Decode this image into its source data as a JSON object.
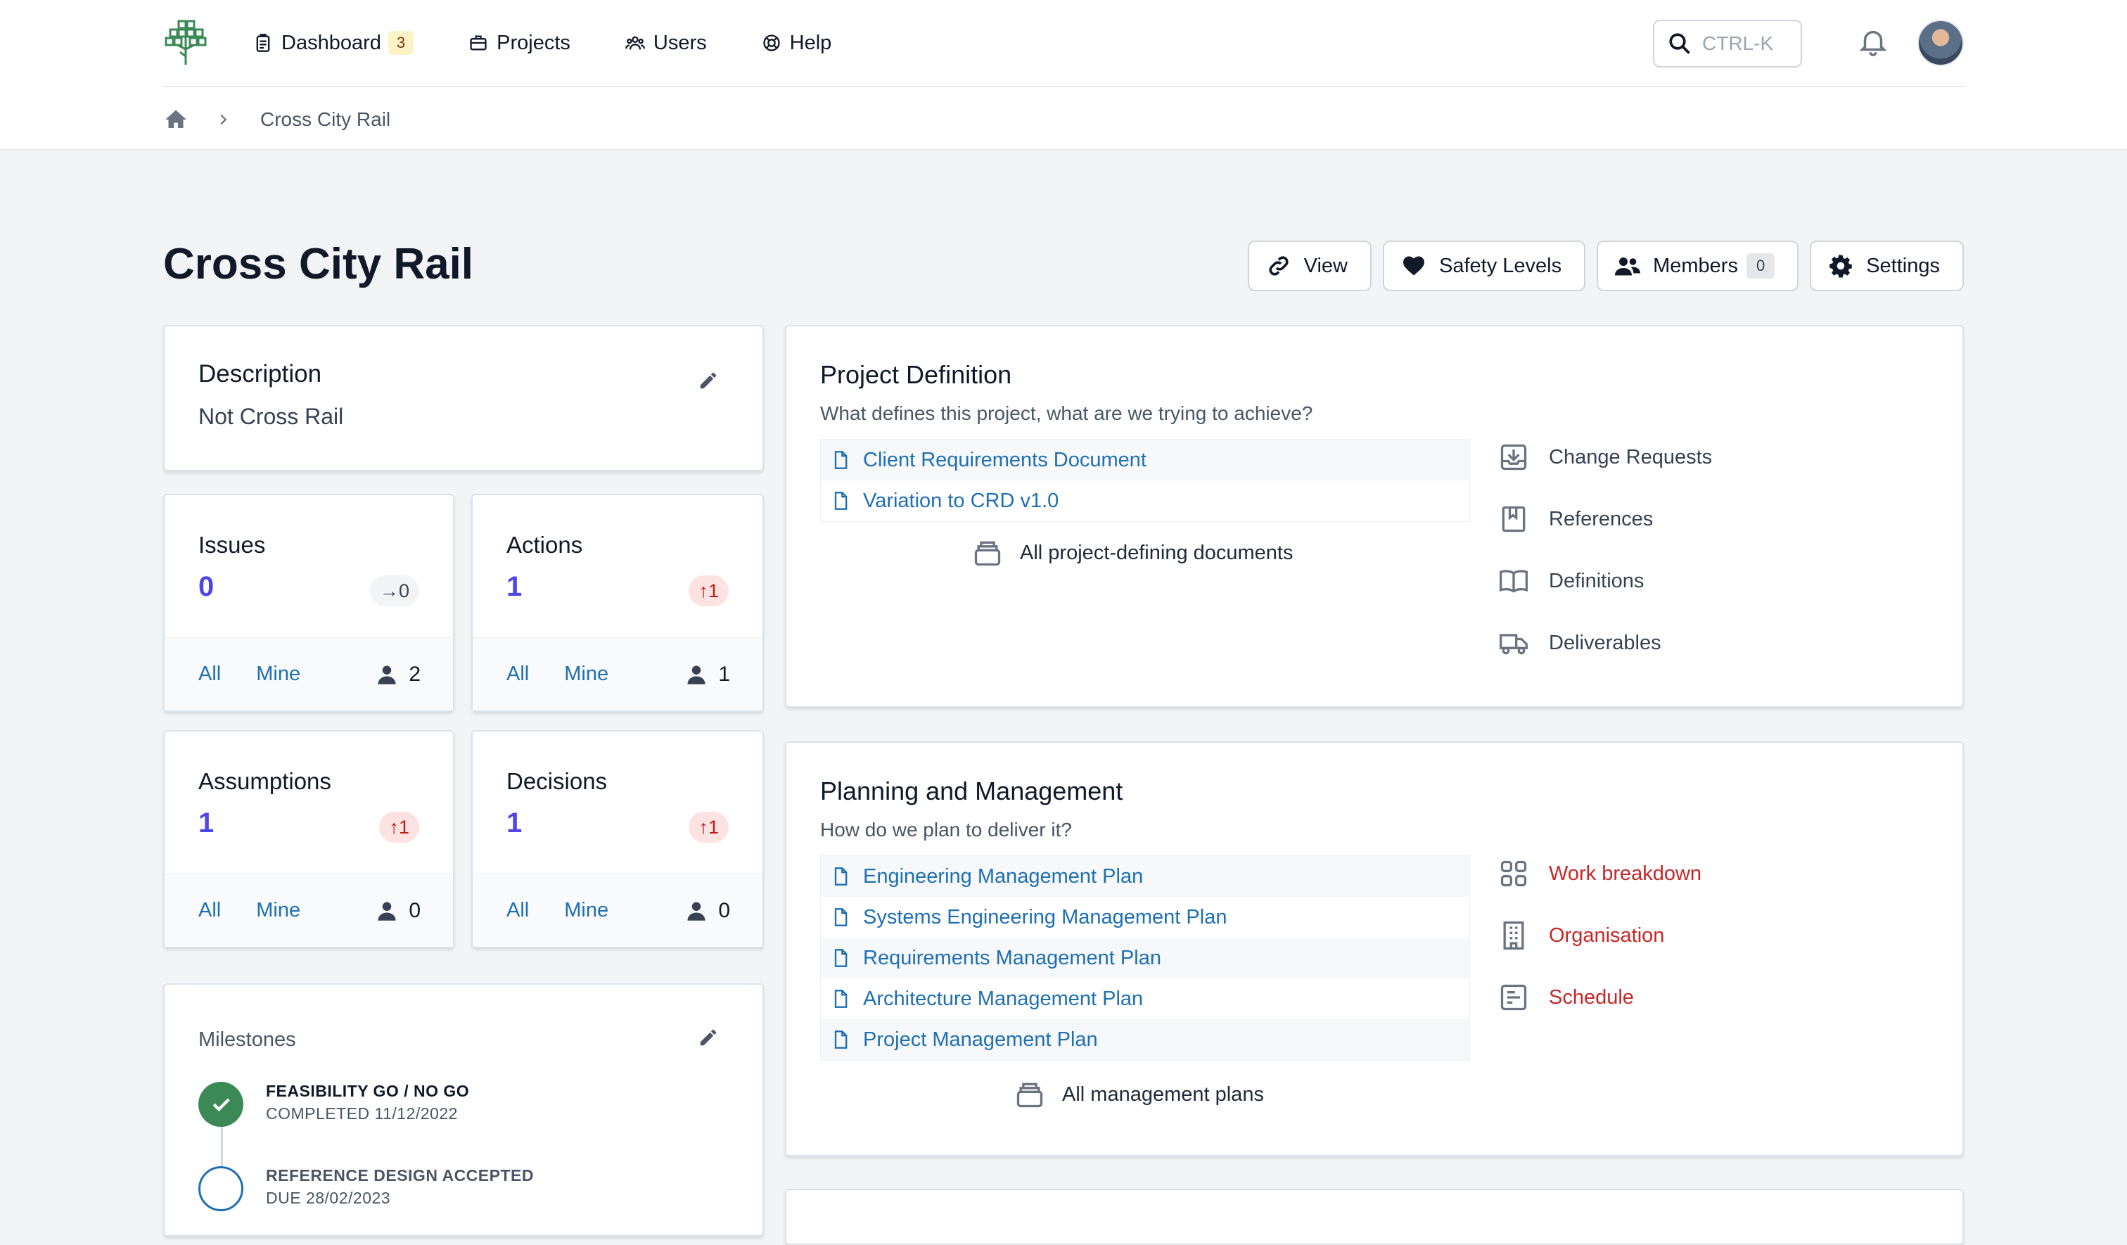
{
  "nav": {
    "items": [
      {
        "label": "Dashboard",
        "badge": "3"
      },
      {
        "label": "Projects"
      },
      {
        "label": "Users"
      },
      {
        "label": "Help"
      }
    ],
    "search_label": "CTRL-K"
  },
  "breadcrumb": {
    "current": "Cross City Rail"
  },
  "page": {
    "title": "Cross City Rail",
    "buttons": {
      "view": "View",
      "safety": "Safety Levels",
      "members": "Members",
      "members_count": "0",
      "settings": "Settings"
    }
  },
  "description": {
    "title": "Description",
    "text": "Not Cross Rail"
  },
  "stats": [
    {
      "label": "Issues",
      "value": "0",
      "trend": "0",
      "trend_dir": "neutral",
      "all": "All",
      "mine": "Mine",
      "people": "2"
    },
    {
      "label": "Actions",
      "value": "1",
      "trend": "1",
      "trend_dir": "up",
      "all": "All",
      "mine": "Mine",
      "people": "1"
    },
    {
      "label": "Assumptions",
      "value": "1",
      "trend": "1",
      "trend_dir": "up",
      "all": "All",
      "mine": "Mine",
      "people": "0"
    },
    {
      "label": "Decisions",
      "value": "1",
      "trend": "1",
      "trend_dir": "up",
      "all": "All",
      "mine": "Mine",
      "people": "0"
    }
  ],
  "milestones": {
    "title": "Milestones",
    "items": [
      {
        "name": "FEASIBILITY GO / NO GO",
        "date": "COMPLETED 11/12/2022",
        "status": "done"
      },
      {
        "name": "REFERENCE DESIGN ACCEPTED",
        "date": "DUE 28/02/2023",
        "status": "pending"
      }
    ]
  },
  "project_definition": {
    "title": "Project Definition",
    "subtitle": "What defines this project, what are we trying to achieve?",
    "docs": [
      "Client Requirements Document",
      "Variation to CRD v1.0"
    ],
    "all_link": "All project-defining documents",
    "side_links": [
      "Change Requests",
      "References",
      "Definitions",
      "Deliverables"
    ]
  },
  "planning": {
    "title": "Planning and Management",
    "subtitle": "How do we plan to deliver it?",
    "docs": [
      "Engineering Management Plan",
      "Systems Engineering Management Plan",
      "Requirements Management Plan",
      "Architecture Management Plan",
      "Project Management Plan"
    ],
    "all_link": "All management plans",
    "side_links": [
      "Work breakdown",
      "Organisation",
      "Schedule"
    ]
  },
  "colors": {
    "accent": "#4f46e5",
    "link": "#1e6fb3",
    "danger": "#c62828",
    "success": "#3b8a55",
    "badge_yellow": "#fef3c7"
  }
}
